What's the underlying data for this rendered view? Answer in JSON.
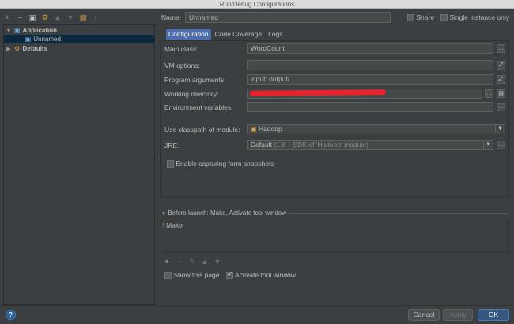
{
  "window": {
    "title": "Run/Debug Configurations"
  },
  "left_toolbar": {
    "icons": [
      "plus-icon",
      "minus-icon",
      "copy-icon",
      "wrench-icon",
      "move-up-icon",
      "move-down-icon",
      "folder-icon",
      "sort-icon"
    ],
    "glyphs": [
      "+",
      "−",
      "▣",
      "⚙",
      "▲",
      "▼",
      "▤",
      "↕"
    ]
  },
  "tree": {
    "items": [
      {
        "label": "Application",
        "arrow": "▼",
        "icon": "▣"
      },
      {
        "label": "Unnamed",
        "arrow": "",
        "icon": "▣"
      },
      {
        "label": "Defaults",
        "arrow": "▶",
        "icon": "⚙"
      }
    ]
  },
  "header": {
    "name_label": "Name:",
    "name_value": "Unnamed",
    "share_label": "Share",
    "single_instance_label": "Single instance only"
  },
  "tabs": [
    {
      "label": "Configuration"
    },
    {
      "label": "Code Coverage"
    },
    {
      "label": "Logs"
    }
  ],
  "form": {
    "main_class_label": "Main class:",
    "main_class_value": "WordCount",
    "vm_options_label": "VM options:",
    "vm_options_value": "",
    "program_args_label": "Program arguments:",
    "program_args_value": "input/ output/",
    "working_dir_label": "Working directory:",
    "working_dir_value": "/",
    "env_vars_label": "Environment variables:",
    "env_vars_value": "",
    "classpath_label": "Use classpath of module:",
    "classpath_value": "Hadoop",
    "jre_label": "JRE:",
    "jre_value": "Default",
    "jre_detail": "(1.8 – SDK of 'Hadoop' module)",
    "capture_label": "Enable capturing form snapshots"
  },
  "before_launch": {
    "title": "Before launch: Make, Activate tool window",
    "items": [
      "Make"
    ],
    "toolbar_glyphs": [
      "+",
      "−",
      "✎",
      "▲",
      "▼"
    ]
  },
  "options": {
    "show_page_label": "Show this page",
    "show_page_checked": false,
    "activate_tool_label": "Activate tool window",
    "activate_tool_checked": true
  },
  "buttons": {
    "help": "?",
    "cancel": "Cancel",
    "apply": "Apply",
    "ok": "OK"
  },
  "colors": {
    "background": "#3c3f41",
    "selection": "#0d293e",
    "accent": "#4b6eaf",
    "redaction": "#e8222a"
  }
}
